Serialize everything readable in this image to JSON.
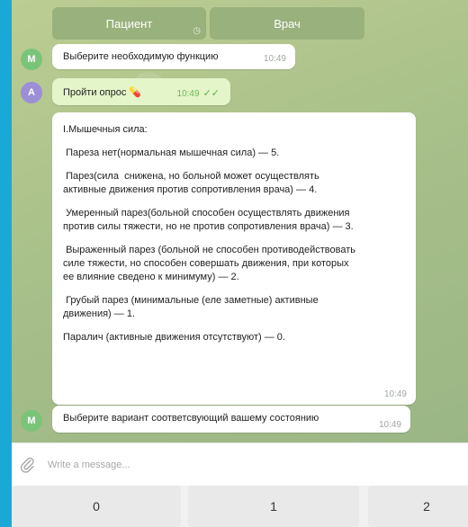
{
  "keyboard_top": [
    "Пациент",
    "Врач"
  ],
  "messages": [
    {
      "avatar": "M",
      "text": "Выберите необходимую функцию",
      "time": "10:49"
    },
    {
      "avatar": "A",
      "text": "Пройти опрос 💊",
      "time": "10:49"
    },
    {
      "paragraphs": [
        "I.Мышечныя сила:",
        " Пареза нет(нормальная мышечная сила) — 5.",
        " Парез(сила  снижена, но больной может осуществлять\nактивные движения против сопротивления врача) — 4.",
        " Умеренный парез(больной способен осуществлять движения\nпротив силы тяжести, но не против сопротивления врача) — 3.",
        " Выраженный парез (больной не способен противодействовать\nсиле тяжести, но способен совершать движения, при которых\nее влияние сведено к минимуму) — 2.",
        " Грубый парез (минимальные (еле заметные) активные\nдвижения) — 1.",
        "Паралич (активные движения отсутствуют) — 0."
      ],
      "time": "10:49"
    },
    {
      "avatar": "M",
      "text": "Выберите вариант соответсвующий вашему состоянию",
      "time": "10:49"
    }
  ],
  "input": {
    "placeholder": "Write a message..."
  },
  "keyboard_bottom": [
    "0",
    "1",
    "2"
  ],
  "icons": {
    "attach": "paperclip-icon",
    "read": "double-check-icon",
    "keyboard": "clock-icon"
  }
}
